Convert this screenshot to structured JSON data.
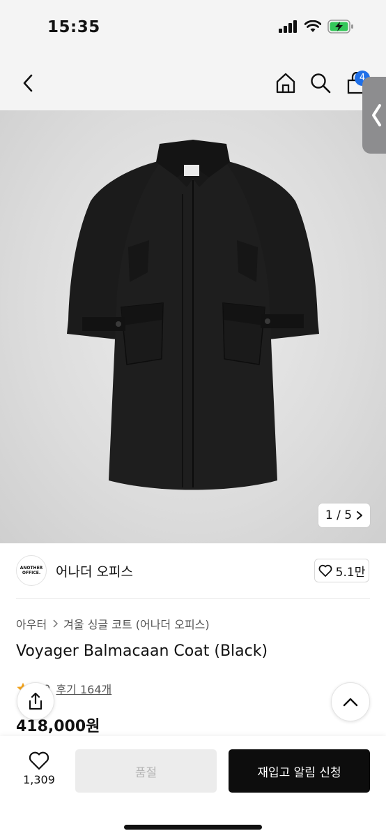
{
  "status_bar": {
    "time": "15:35"
  },
  "nav": {
    "cart_count": "4"
  },
  "gallery": {
    "counter": "1 / 5"
  },
  "brand": {
    "logo_line1": "ANOTHER",
    "logo_line2": "OFFICE.",
    "name": "어나더 오피스",
    "likes": "5.1만"
  },
  "breadcrumb": {
    "category": "아우터",
    "subcategory": "겨울 싱글 코트 (어나더 오피스)"
  },
  "product": {
    "title": "Voyager Balmacaan Coat (Black)",
    "rating": "4.9",
    "reviews": "후기 164개",
    "price": "418,000원"
  },
  "bottom": {
    "wish_count": "1,309",
    "soldout_label": "품절",
    "restock_label": "재입고 알림 신청"
  },
  "colors": {
    "accent": "#1f6fe8",
    "primary_button": "#0d0d0d",
    "rating_star": "#f2a21b"
  },
  "icons": [
    "back-icon",
    "home-icon",
    "search-icon",
    "cart-icon",
    "chevron-right-icon",
    "heart-icon",
    "share-icon",
    "chevron-up-icon",
    "star-icon"
  ]
}
